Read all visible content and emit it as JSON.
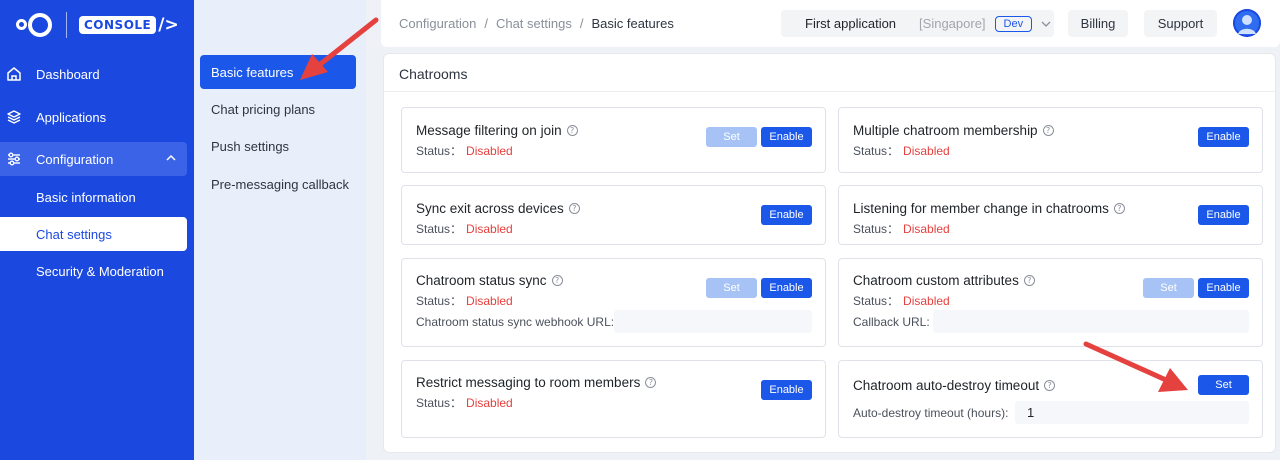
{
  "brand": {
    "console_label": "CONSOLE",
    "console_glyph": "/>"
  },
  "leftnav": {
    "items": [
      {
        "label": "Dashboard",
        "icon": "home-icon"
      },
      {
        "label": "Applications",
        "icon": "layers-icon"
      },
      {
        "label": "Configuration",
        "icon": "sliders-icon",
        "expanded": true
      }
    ],
    "sub_items": [
      {
        "label": "Basic information"
      },
      {
        "label": "Chat settings",
        "active": true
      },
      {
        "label": "Security & Moderation"
      }
    ]
  },
  "secnav": {
    "items": [
      {
        "label": "Basic features",
        "active": true
      },
      {
        "label": "Chat pricing plans"
      },
      {
        "label": "Push settings"
      },
      {
        "label": "Pre-messaging callback"
      }
    ]
  },
  "topbar": {
    "breadcrumb": [
      "Configuration",
      "/",
      "Chat settings",
      "/",
      "Basic features"
    ],
    "app_name": "First application",
    "region": "[Singapore]",
    "env_badge": "Dev",
    "billing_label": "Billing",
    "support_label": "Support"
  },
  "section_title": "Chatrooms",
  "status_prefix": "Status：",
  "cards": {
    "message_filtering": {
      "title": "Message filtering on join",
      "status": "Disabled",
      "set_label": "Set",
      "enable_label": "Enable"
    },
    "multiple_membership": {
      "title": "Multiple chatroom membership",
      "status": "Disabled",
      "enable_label": "Enable"
    },
    "sync_exit": {
      "title": "Sync exit across devices",
      "status": "Disabled",
      "enable_label": "Enable"
    },
    "member_change": {
      "title": "Listening for member change in chatrooms",
      "status": "Disabled",
      "enable_label": "Enable"
    },
    "status_sync": {
      "title": "Chatroom status sync",
      "status": "Disabled",
      "set_label": "Set",
      "enable_label": "Enable",
      "field_label": "Chatroom status sync webhook URL:",
      "field_value": ""
    },
    "custom_attributes": {
      "title": "Chatroom custom attributes",
      "status": "Disabled",
      "set_label": "Set",
      "enable_label": "Enable",
      "field_label": "Callback URL:",
      "field_value": ""
    },
    "restrict_messaging": {
      "title": "Restrict messaging to room members",
      "status": "Disabled",
      "enable_label": "Enable"
    },
    "auto_destroy": {
      "title": "Chatroom auto-destroy timeout",
      "set_label": "Set",
      "field_label": "Auto-destroy timeout (hours):",
      "field_value": "1"
    }
  },
  "colors": {
    "nav_blue": "#1b49e0",
    "primary": "#1b57e8",
    "disabled_status": "#e5413e",
    "annotation_arrow": "#e5413e"
  }
}
